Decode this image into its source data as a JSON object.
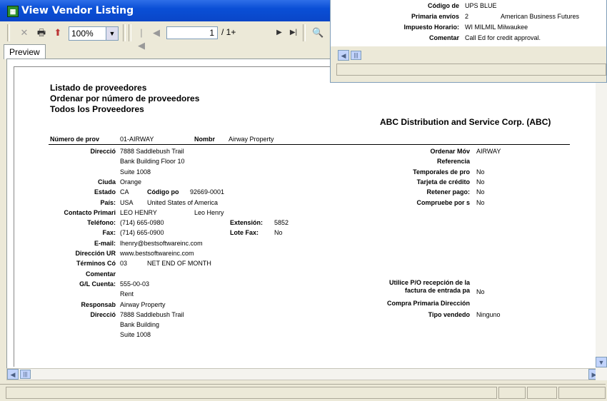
{
  "window": {
    "title": "View Vendor Listing",
    "app_icon": "report-app-icon"
  },
  "toolbar": {
    "zoom": "100%",
    "page_current": "1",
    "page_total": "/ 1+"
  },
  "tabs": [
    "Preview"
  ],
  "report": {
    "title_lines": [
      "Listado de proveedores",
      "Ordenar por número de proveedores",
      "Todos los Proveedores"
    ],
    "company": "ABC Distribution and Service Corp. (ABC)",
    "vendor_no_label": "Número de prov",
    "vendor_no": "01-AIRWAY",
    "name_label": "Nombr",
    "name": "Airway Property",
    "left": [
      {
        "label": "Direcció",
        "value": "7888 Saddlebush Trail"
      },
      {
        "label": "",
        "value": "Bank Building Floor 10"
      },
      {
        "label": "",
        "value": "Suite 1008"
      },
      {
        "label": "Ciuda",
        "value": "Orange"
      },
      {
        "label": "Estado",
        "value": "CA",
        "extra_label": "Código po",
        "extra": "92669-0001"
      },
      {
        "label": "País:",
        "value": "USA",
        "extra": "United States of America"
      },
      {
        "label": "Contacto Primari",
        "value": "LEO HENRY",
        "extra": "Leo Henry"
      },
      {
        "label": "Teléfono:",
        "value": "(714) 665-0980",
        "extra_label": "Extensión:",
        "extra": "5852"
      },
      {
        "label": "Fax:",
        "value": "(714) 665-0900",
        "extra_label": "Lote Fax:",
        "extra": "No"
      },
      {
        "label": "E-mail:",
        "value": "lhenry@bestsoftwareinc.com"
      },
      {
        "label": "Dirección UR",
        "value": "www.bestsoftwareinc.com"
      },
      {
        "label": "Términos Có",
        "value": "03",
        "extra": "NET END OF MONTH"
      },
      {
        "label": "Comentar",
        "value": ""
      },
      {
        "label": "G/L Cuenta:",
        "value": "555-00-03"
      },
      {
        "label": "",
        "value": "Rent"
      },
      {
        "label": "Responsab",
        "value": "Airway Property"
      },
      {
        "label": "Direcció",
        "value": "7888 Saddlebush Trail"
      },
      {
        "label": "",
        "value": "Bank Building"
      },
      {
        "label": "",
        "value": "Suite 1008"
      }
    ],
    "right": [
      {
        "label": "Ordenar Móv",
        "value": "AIRWAY"
      },
      {
        "label": "Referencia",
        "value": ""
      },
      {
        "label": "Temporales de pro",
        "value": "No"
      },
      {
        "label": "Tarjeta de crédito",
        "value": "No"
      },
      {
        "label": "Retener pago:",
        "value": "No"
      },
      {
        "label": "Compruebe por s",
        "value": "No"
      }
    ],
    "right_lower": [
      {
        "label": "Utilice P/O recepción de la",
        "label2": "factura de entrada pa",
        "value": "No"
      },
      {
        "label": "Compra Primaria Dirección",
        "value": ""
      },
      {
        "label": "Tipo vendedo",
        "value": "Ninguno"
      }
    ]
  },
  "popup": {
    "rows": [
      {
        "label": "Código de",
        "value": "UPS BLUE"
      },
      {
        "label": "Primaria envíos",
        "value": "2",
        "extra": "American Business Futures"
      },
      {
        "label": "Impuesto Horario:",
        "value": "WI MILMIL Milwaukee"
      },
      {
        "label": "Comentar",
        "value": "Call Ed for credit approval."
      }
    ]
  }
}
